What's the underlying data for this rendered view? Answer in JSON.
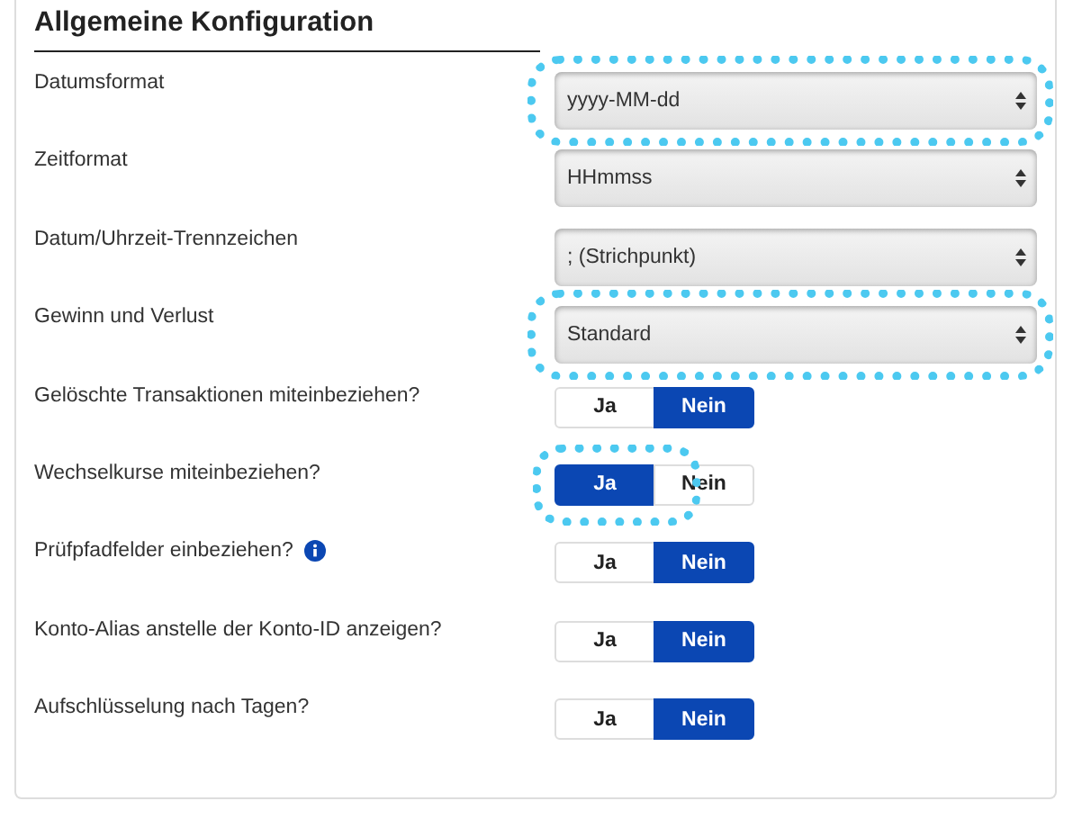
{
  "section": {
    "title": "Allgemeine Konfiguration"
  },
  "rows": [
    {
      "label": "Datumsformat",
      "kind": "select",
      "value": "yyyy-MM-dd",
      "info": false,
      "highlighted": true
    },
    {
      "label": "Zeitformat",
      "kind": "select",
      "value": "HHmmss",
      "info": false,
      "highlighted": false
    },
    {
      "label": "Datum/Uhrzeit-Trennzeichen",
      "kind": "select",
      "value": "; (Strichpunkt)",
      "info": false,
      "highlighted": false
    },
    {
      "label": "Gewinn und Verlust",
      "kind": "select",
      "value": "Standard",
      "info": false,
      "highlighted": true
    },
    {
      "label": "Gelöschte Transaktionen miteinbeziehen?",
      "kind": "toggle",
      "options": [
        {
          "label": "Ja",
          "selected": false
        },
        {
          "label": "Nein",
          "selected": true
        }
      ],
      "info": false,
      "highlighted": false
    },
    {
      "label": "Wechselkurse miteinbeziehen?",
      "kind": "toggle",
      "options": [
        {
          "label": "Ja",
          "selected": true
        },
        {
          "label": "Nein",
          "selected": false
        }
      ],
      "info": false,
      "highlighted": true
    },
    {
      "label": "Prüfpfadfelder einbeziehen?",
      "kind": "toggle",
      "options": [
        {
          "label": "Ja",
          "selected": false
        },
        {
          "label": "Nein",
          "selected": true
        }
      ],
      "info": true,
      "highlighted": false
    },
    {
      "label": "Konto-Alias anstelle der Konto-ID anzeigen?",
      "kind": "toggle",
      "options": [
        {
          "label": "Ja",
          "selected": false
        },
        {
          "label": "Nein",
          "selected": true
        }
      ],
      "info": false,
      "highlighted": false
    },
    {
      "label": "Aufschlüsselung nach Tagen?",
      "kind": "toggle",
      "options": [
        {
          "label": "Ja",
          "selected": false
        },
        {
          "label": "Nein",
          "selected": true
        }
      ],
      "info": false,
      "highlighted": false
    }
  ]
}
